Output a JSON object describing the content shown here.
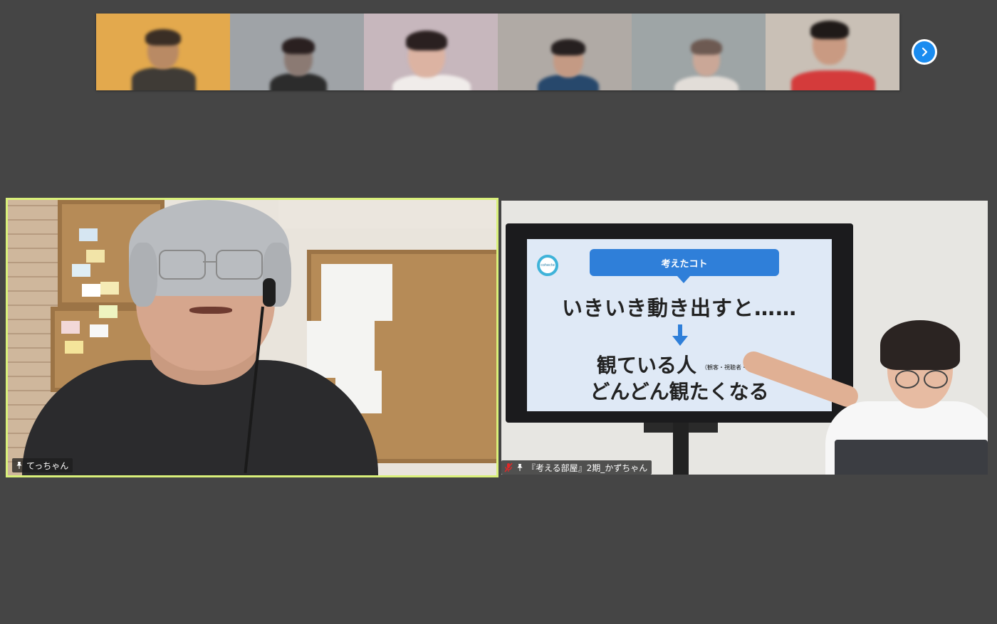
{
  "filmstrip": {
    "participants": [
      {
        "bg": "#e3a94d",
        "skin": "#b98a64",
        "shirt": "#3f3b36",
        "hair": "#3a2e25"
      },
      {
        "bg": "#9fa3a7",
        "skin": "#8b7a73",
        "shirt": "#2c2c2c",
        "hair": "#2a2020"
      },
      {
        "bg": "#c7b7bd",
        "skin": "#dcb3a2",
        "shirt": "#f0ecea",
        "hair": "#2a2020"
      },
      {
        "bg": "#b0aaa5",
        "skin": "#c49a84",
        "shirt": "#27486c",
        "hair": "#262020"
      },
      {
        "bg": "#9ea5a6",
        "skin": "#caa797",
        "shirt": "#e2ddd8",
        "hair": "#6d5a52"
      },
      {
        "bg": "#c9c0b6",
        "skin": "#c99a82",
        "shirt": "#d43b3b",
        "hair": "#1f1a18"
      }
    ],
    "next_icon": "chevron-right-icon",
    "accent_color": "#1a8cf0"
  },
  "tiles": {
    "left": {
      "name": "てっちゃん",
      "pin_icon": "pin-icon",
      "active_speaker_color": "#d9f07a"
    },
    "right": {
      "name": "『考える部屋』2期_かずちゃん",
      "muted_icon": "mic-muted-icon",
      "pin_icon": "pin-icon",
      "slide": {
        "logo_text": "cohecte",
        "tag": "考えたコト",
        "line1": "いきいき動き出すと……",
        "line2": "観ている人",
        "line2_note": "（観客・視聴者・読者）",
        "line3": "どんどん観たくなる"
      }
    }
  }
}
